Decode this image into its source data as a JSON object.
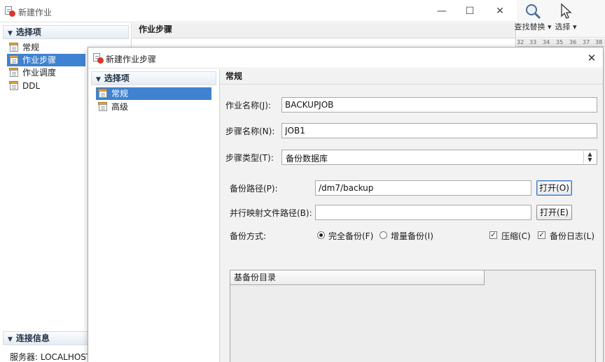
{
  "background_window": {
    "title": "新建作业",
    "controls": {
      "minimize": "—",
      "maximize": "☐",
      "close": "✕"
    },
    "left_panel": {
      "section_title": "选择项",
      "items": [
        {
          "label": "常规",
          "selected": false
        },
        {
          "label": "作业步骤",
          "selected": true
        },
        {
          "label": "作业调度",
          "selected": false
        },
        {
          "label": "DDL",
          "selected": false
        }
      ],
      "connection_section_title": "连接信息",
      "server_label": "服务器: LOCALHOST"
    },
    "right_header": "作业步骤"
  },
  "toolbar": {
    "find_replace_label": "查找替换",
    "select_label": "选择",
    "ruler_numbers": [
      "32",
      "33",
      "34",
      "35",
      "36",
      "37",
      "38"
    ]
  },
  "dialog": {
    "title": "新建作业步骤",
    "close": "✕",
    "left_panel": {
      "section_title": "选择项",
      "items": [
        {
          "label": "常规",
          "selected": true
        },
        {
          "label": "高级",
          "selected": false
        }
      ]
    },
    "right_header": "常规",
    "form": {
      "job_name_label": "作业名称(J):",
      "job_name_value": "BACKUPJOB",
      "step_name_label": "步骤名称(N):",
      "step_name_value": "JOB1",
      "step_type_label": "步骤类型(T):",
      "step_type_value": "备份数据库",
      "backup_path_label": "备份路径(P):",
      "backup_path_value": "/dm7/backup",
      "open_button_1": "打开(O)",
      "parallel_map_label": "并行映射文件路径(B):",
      "parallel_map_value": "",
      "open_button_2": "打开(E)",
      "backup_mode_label": "备份方式:",
      "full_backup_label": "完全备份(F)",
      "full_backup_checked": true,
      "incremental_backup_label": "增量备份(I)",
      "incremental_backup_checked": false,
      "compress_label": "压缩(C)",
      "compress_checked": true,
      "backup_log_label": "备份日志(L)",
      "backup_log_checked": true,
      "base_backup_dir_header": "基备份目录"
    }
  },
  "colors": {
    "selection": "#3f82cf",
    "focus_border": "#3b79c6",
    "icon_badge": "#d9372b"
  }
}
